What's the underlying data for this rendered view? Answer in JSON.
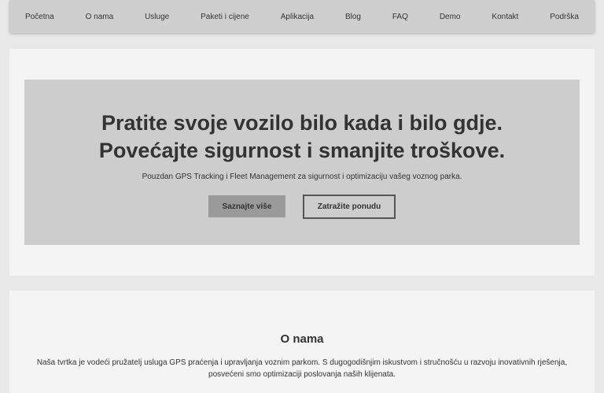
{
  "nav": {
    "items": [
      "Početna",
      "O nama",
      "Usluge",
      "Paketi i cijene",
      "Aplikacija",
      "Blog",
      "FAQ",
      "Demo",
      "Kontakt",
      "Podrška"
    ]
  },
  "hero": {
    "title_line1": "Pratite svoje vozilo bilo kada i bilo gdje.",
    "title_line2": "Povećajte sigurnost i smanjite troškove.",
    "subtitle": "Pouzdan GPS Tracking i Fleet Management za sigurnost i optimizaciju vašeg voznog parka.",
    "primary_button": "Saznajte više",
    "secondary_button": "Zatražite ponudu"
  },
  "about": {
    "title": "O nama",
    "text": "Naša tvrtka je vodeći pružatelj usluga GPS praćenja i upravljanja voznim parkom. S dugogodišnjim iskustvom i stručnošću u razvoju inovativnih rješenja, posvećeni smo optimizaciji poslovanja naših klijenata."
  }
}
